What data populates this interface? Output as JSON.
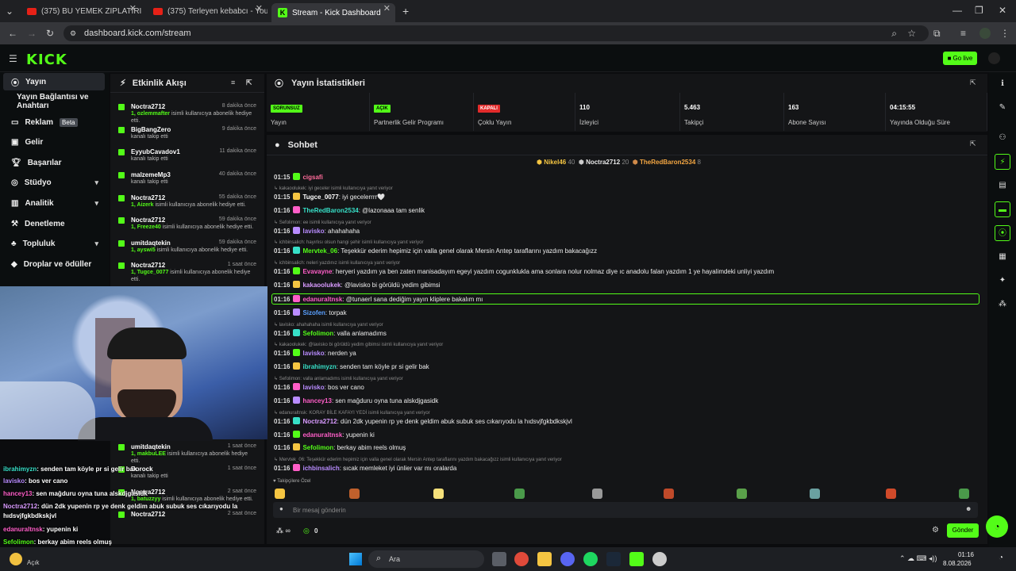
{
  "browser": {
    "tabs": [
      {
        "label": "(375) BU YEMEK ZIPLATIRI ELRA..."
      },
      {
        "label": "(375) Terleyen kebabcı - YouTu..."
      },
      {
        "label": "Stream - Kick Dashboard"
      }
    ],
    "url": "dashboard.kick.com/stream"
  },
  "header": {
    "logo": "KICK",
    "go_live": "Go live"
  },
  "sidebar": {
    "items": [
      {
        "label": "Yayın"
      },
      {
        "label": "Yayın Bağlantısı ve Anahtarı"
      },
      {
        "label": "Reklam",
        "badge": "Beta"
      },
      {
        "label": "Gelir"
      },
      {
        "label": "Başarılar"
      },
      {
        "label": "Stüdyo"
      },
      {
        "label": "Analitik"
      },
      {
        "label": "Denetleme"
      },
      {
        "label": "Topluluk"
      },
      {
        "label": "Droplar ve ödüller"
      }
    ]
  },
  "activity": {
    "title": "Etkinlik Akışı",
    "items": [
      {
        "name": "Noctra2712",
        "time": "8 dakika önce",
        "desc_bold": "1, ozlemmafter",
        "desc": " isimli kullanıcıya abonelik hediye etti."
      },
      {
        "name": "BigBangZero",
        "time": "9 dakika önce",
        "desc_bold": "",
        "desc": "kanalı takip etti"
      },
      {
        "name": "EyyubCavadov1",
        "time": "11 dakika önce",
        "desc_bold": "",
        "desc": "kanalı takip etti"
      },
      {
        "name": "malzemeMp3",
        "time": "40 dakika önce",
        "desc_bold": "",
        "desc": "kanalı takip etti"
      },
      {
        "name": "Noctra2712",
        "time": "55 dakika önce",
        "desc_bold": "1, Aizerk",
        "desc": " isimli kullanıcıya abonelik hediye etti."
      },
      {
        "name": "Noctra2712",
        "time": "59 dakika önce",
        "desc_bold": "1, Freeze40",
        "desc": " isimli kullanıcıya abonelik hediye etti."
      },
      {
        "name": "umitdaqtekin",
        "time": "59 dakika önce",
        "desc_bold": "1, ayswi5",
        "desc": " isimli kullanıcıya abonelik hediye etti."
      },
      {
        "name": "Noctra2712",
        "time": "1 saat önce",
        "desc_bold": "1, Tugce_0077",
        "desc": " isimli kullanıcıya abonelik hediye etti."
      },
      {
        "name": "umitdaqtekin",
        "time": "1 saat önce",
        "desc_bold": "1, makbuLEE",
        "desc": " isimli kullanıcıya abonelik hediye etti."
      },
      {
        "name": "Dorock",
        "time": "1 saat önce",
        "desc_bold": "",
        "desc": "kanalı takip etti"
      },
      {
        "name": "Noctra2712",
        "time": "2 saat önce",
        "desc_bold": "1, batuzzyy",
        "desc": " isimli kullanıcıya abonelik hediye etti."
      },
      {
        "name": "Noctra2712",
        "time": "2 saat önce",
        "desc_bold": "",
        "desc": ""
      }
    ]
  },
  "stats": {
    "title": "Yayın İstatistikleri",
    "cells": [
      {
        "pill": "SORUNSUZ",
        "pill_color": "#53fc18",
        "label": "Yayın"
      },
      {
        "pill": "AÇIK",
        "pill_color": "#53fc18",
        "label": "Partnerlik Gelir Programı"
      },
      {
        "pill": "KAPALI",
        "pill_color": "#e22b2b",
        "label": "Çoklu Yayın"
      },
      {
        "value": "110",
        "label": "İzleyici"
      },
      {
        "value": "5.463",
        "label": "Takipçi"
      },
      {
        "value": "163",
        "label": "Abone Sayısı"
      },
      {
        "value": "04:15:55",
        "label": "Yayında Olduğu Süre"
      }
    ]
  },
  "chat": {
    "title": "Sohbet",
    "top": [
      {
        "name": "Nikel46",
        "count": "40"
      },
      {
        "name": "Noctra2712",
        "count": "20"
      },
      {
        "name": "TheRedBaron2534",
        "count": "8"
      }
    ],
    "messages": [
      {
        "time": "01:15",
        "user": "cigsafi",
        "color": "#ff6b9a",
        "text": "",
        "reply": ""
      },
      {
        "time": "01:15",
        "user": "Tugce_0077",
        "color": "#ffffff",
        "text": ": iyi gecelerrrr🤍",
        "reply": "kakaoolukek: iyi geceler isimli kullanıcıya yanıt veriyor"
      },
      {
        "time": "01:16",
        "user": "TheRedBaron2534",
        "color": "#37e0c8",
        "text": ": @lazonaaa tam senlik",
        "reply": ""
      },
      {
        "time": "01:16",
        "user": "lavisko",
        "color": "#b98cff",
        "text": ": ahahahaha",
        "reply": "Sefolimon: ee isimli kullanıcıya yanıt veriyor"
      },
      {
        "time": "01:16",
        "user": "Mervtek_06",
        "color": "#53fc18",
        "text": ": Teşekkür ederim hepimiz için valla genel olarak Mersin Antep taraflarını yazdım bakacağızz",
        "reply": "ichbinsalich: hayırlısı olsun hangi şehir isimli kullanıcıya yanıt veriyor"
      },
      {
        "time": "01:16",
        "user": "Evavayne",
        "color": "#ff5ec8",
        "text": ": heryeri yazdım ya ben zaten manisadayım egeyi yazdım cogunklukla ama sonlara nolur nolmaz diye ıc anadolu falan yazdım 1 ye hayalimdeki unliyi yazdım",
        "reply": "ichbinsalich: neleri yazdınız isimli kullanıcıya yanıt veriyor"
      },
      {
        "time": "01:16",
        "user": "kakaoolukek",
        "color": "#d99bff",
        "text": ": @lavisko bi görüldü yedim gibimsi",
        "reply": ""
      },
      {
        "time": "01:16",
        "user": "edanuraltnsk",
        "color": "#ff5ec8",
        "text": ": @tunaerl sana dediğim yayın kliplere bakalım mı",
        "reply": ""
      },
      {
        "time": "01:16",
        "user": "Sizofen",
        "color": "#5aa0ff",
        "text": ": torpak",
        "reply": ""
      },
      {
        "time": "01:16",
        "user": "Sefolimon",
        "color": "#53fc18",
        "text": ": valla anlamadıms",
        "reply": "lavisko: ahahahaha isimli kullanıcıya yanıt veriyor"
      },
      {
        "time": "01:16",
        "user": "lavisko",
        "color": "#b98cff",
        "text": ": nerden ya",
        "reply": "kakaoolukek: @lavisko bi görüldü yedim gibimsi isimli kullanıcıya yanıt veriyor"
      },
      {
        "time": "01:16",
        "user": "ibrahimyzn",
        "color": "#37e0c8",
        "text": ": senden tam köyle pr si gelir bak",
        "reply": ""
      },
      {
        "time": "01:16",
        "user": "lavisko",
        "color": "#b98cff",
        "text": ": bos ver cano",
        "reply": "Sefolimon: valla anlamadıms isimli kullanıcıya yanıt veriyor"
      },
      {
        "time": "01:16",
        "user": "hancey13",
        "color": "#ff5ec8",
        "text": ": sen mağduru oyna tuna alskdjgasidk",
        "reply": ""
      },
      {
        "time": "01:16",
        "user": "Noctra2712",
        "color": "#d99bff",
        "text": ": dün 2dk yupenin rp ye denk geldim abuk subuk ses cıkarıyodu la hıdsvjfgkbdkskjvl",
        "reply": "edanuraltnsk: KORAY BİLE KAFAYI YEDİ isimli kullanıcıya yanıt veriyor"
      },
      {
        "time": "01:16",
        "user": "edanuraltnsk",
        "color": "#ff5ec8",
        "text": ": yupenin ki",
        "reply": ""
      },
      {
        "time": "01:16",
        "user": "Sefolimon",
        "color": "#53fc18",
        "text": ": berkay abim reels olmuş",
        "reply": ""
      },
      {
        "time": "01:16",
        "user": "ichbinsalich",
        "color": "#b98cff",
        "text": ": sıcak memleket iyi ünlier var mı oralarda",
        "reply": "Mervtek_06: Teşekkür ederim hepimiz için valla genel olarak Mersin Antep taraflarını yazdım bakacağızz isimli kullanıcıya yanıt veriyor"
      }
    ],
    "emote_label": "Takipçilere Özel",
    "input_placeholder": "Bir mesaj gönderin",
    "points": "0",
    "send": "Gönder"
  },
  "overlay": {
    "lines": [
      {
        "user": "ibrahimyzn",
        "color": "#37e0c8",
        "text": ": senden tam köyle pr si gelir bak"
      },
      {
        "user": "lavisko",
        "color": "#b98cff",
        "text": ": bos ver cano"
      },
      {
        "user": "hancey13",
        "color": "#ff5ec8",
        "text": ": sen mağduru oyna tuna alskdjgasidk"
      },
      {
        "user": "Noctra2712",
        "color": "#d99bff",
        "text": ": dün 2dk yupenin rp ye denk geldim abuk subuk ses cıkarıyodu la hıdsvjfgkbdkskjvl"
      },
      {
        "user": "edanuraltnsk",
        "color": "#ff5ec8",
        "text": ": yupenin ki"
      },
      {
        "user": "Sefolimon",
        "color": "#53fc18",
        "text": ": berkay abim reels olmuş"
      },
      {
        "user": "ichbinsalich",
        "color": "#b98cff",
        "text": ": sıcak memleket iyi ünlier var mı oralarda"
      }
    ]
  },
  "taskbar": {
    "search": "Ara",
    "weather": "Açık",
    "time": "01:16",
    "date": "8.08.2026"
  }
}
